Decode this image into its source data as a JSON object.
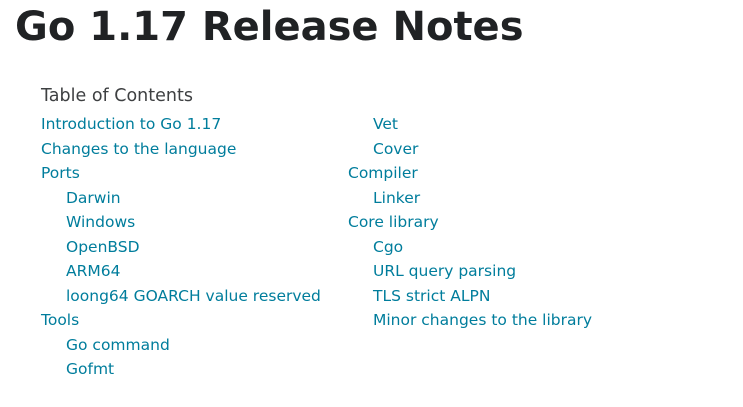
{
  "page": {
    "title": "Go 1.17 Release Notes"
  },
  "toc": {
    "heading": "Table of Contents",
    "left": [
      {
        "label": "Introduction to Go 1.17",
        "level": 1
      },
      {
        "label": "Changes to the language",
        "level": 1
      },
      {
        "label": "Ports",
        "level": 1
      },
      {
        "label": "Darwin",
        "level": 2
      },
      {
        "label": "Windows",
        "level": 2
      },
      {
        "label": "OpenBSD",
        "level": 2
      },
      {
        "label": "ARM64",
        "level": 2
      },
      {
        "label": "loong64 GOARCH value reserved",
        "level": 2
      },
      {
        "label": "Tools",
        "level": 1
      },
      {
        "label": "Go command",
        "level": 2
      },
      {
        "label": "Gofmt",
        "level": 2
      }
    ],
    "right": [
      {
        "label": "Vet",
        "level": 2
      },
      {
        "label": "Cover",
        "level": 2
      },
      {
        "label": "Compiler",
        "level": 1
      },
      {
        "label": "Linker",
        "level": 2
      },
      {
        "label": "Core library",
        "level": 1
      },
      {
        "label": "Cgo",
        "level": 2
      },
      {
        "label": "URL query parsing",
        "level": 2
      },
      {
        "label": "TLS strict ALPN",
        "level": 2
      },
      {
        "label": "Minor changes to the library",
        "level": 2
      }
    ]
  },
  "colors": {
    "link": "#007d9c",
    "text": "#202224"
  }
}
